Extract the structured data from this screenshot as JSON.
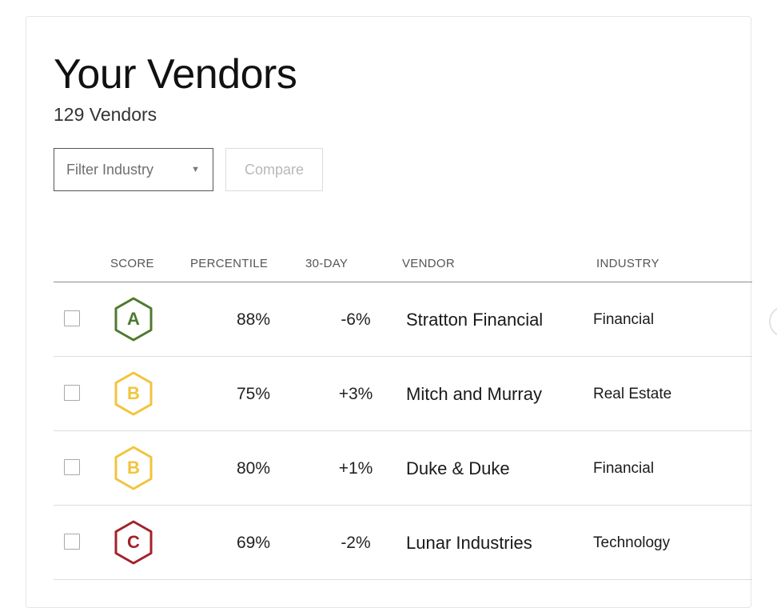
{
  "header": {
    "title": "Your Vendors",
    "count": "129 Vendors"
  },
  "toolbar": {
    "filter_label": "Filter Industry",
    "filter_caret": "▼",
    "compare_label": "Compare"
  },
  "table": {
    "columns": {
      "score": "SCORE",
      "percentile": "PERCENTILE",
      "change": "30-DAY",
      "vendor": "VENDOR",
      "industry": "INDUSTRY"
    },
    "rows": [
      {
        "grade": "A",
        "grade_color": "#4e7a2e",
        "percentile": "88%",
        "change": "-6%",
        "vendor": "Stratton Financial",
        "industry": "Financial"
      },
      {
        "grade": "B",
        "grade_color": "#f2c43c",
        "percentile": "75%",
        "change": "+3%",
        "vendor": "Mitch and Murray",
        "industry": "Real Estate"
      },
      {
        "grade": "B",
        "grade_color": "#f2c43c",
        "percentile": "80%",
        "change": "+1%",
        "vendor": "Duke & Duke",
        "industry": "Financial"
      },
      {
        "grade": "C",
        "grade_color": "#a3222a",
        "percentile": "69%",
        "change": "-2%",
        "vendor": "Lunar Industries",
        "industry": "Technology"
      }
    ]
  },
  "icons": {
    "score_badge_shape": "hexagon-icon",
    "dropdown_caret": "caret-down-icon"
  }
}
